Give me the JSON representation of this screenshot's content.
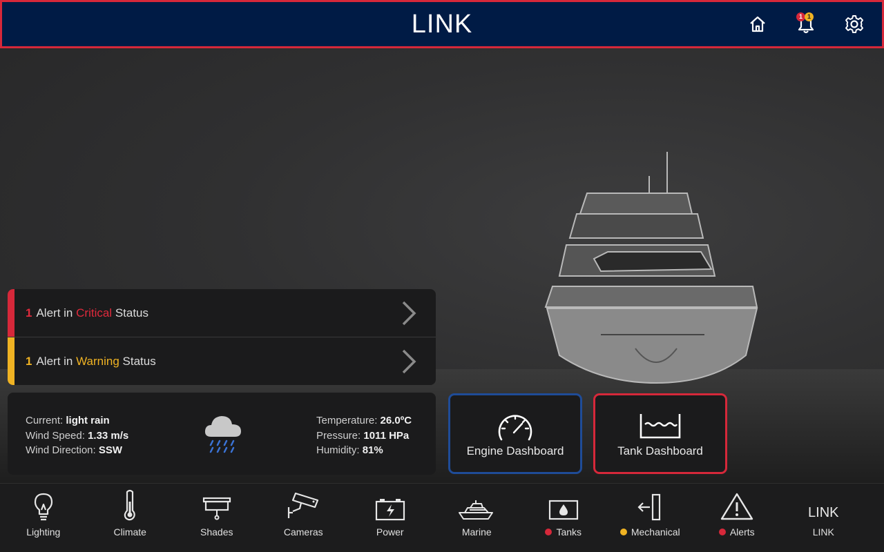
{
  "header": {
    "title": "LINK",
    "notifications": {
      "critical_count": "1",
      "warning_count": "1"
    }
  },
  "alerts": {
    "critical": {
      "count": "1",
      "prefix": "Alert in",
      "status": "Critical",
      "suffix": "Status"
    },
    "warning": {
      "count": "1",
      "prefix": "Alert in",
      "status": "Warning",
      "suffix": "Status"
    }
  },
  "weather": {
    "current_label": "Current:",
    "current_value": "light rain",
    "wind_speed_label": "Wind Speed:",
    "wind_speed_value": "1.33 m/s",
    "wind_direction_label": "Wind Direction:",
    "wind_direction_value": "SSW",
    "temperature_label": "Temperature:",
    "temperature_value": "26.0ºC",
    "pressure_label": "Pressure:",
    "pressure_value": "1011 HPa",
    "humidity_label": "Humidity:",
    "humidity_value": "81%",
    "icon": "rain-cloud-icon"
  },
  "dashboards": {
    "engine": {
      "label": "Engine Dashboard",
      "icon": "gauge-icon"
    },
    "tank": {
      "label": "Tank Dashboard",
      "icon": "tank-level-icon"
    }
  },
  "nav": [
    {
      "label": "Lighting",
      "icon": "bulb-icon"
    },
    {
      "label": "Climate",
      "icon": "thermometer-icon"
    },
    {
      "label": "Shades",
      "icon": "shade-icon"
    },
    {
      "label": "Cameras",
      "icon": "camera-icon"
    },
    {
      "label": "Power",
      "icon": "battery-icon"
    },
    {
      "label": "Marine",
      "icon": "yacht-icon"
    },
    {
      "label": "Tanks",
      "icon": "tank-icon",
      "status": "critical"
    },
    {
      "label": "Mechanical",
      "icon": "mechanical-icon",
      "status": "warning"
    },
    {
      "label": "Alerts",
      "icon": "warning-triangle-icon",
      "status": "critical"
    },
    {
      "label": "LINK",
      "icon_text": "LINK"
    }
  ],
  "colors": {
    "header_bg": "#001b45",
    "critical": "#d6283a",
    "warning": "#f0b323",
    "engine_border": "#1f4c98",
    "panel_bg": "#1b1b1c"
  }
}
